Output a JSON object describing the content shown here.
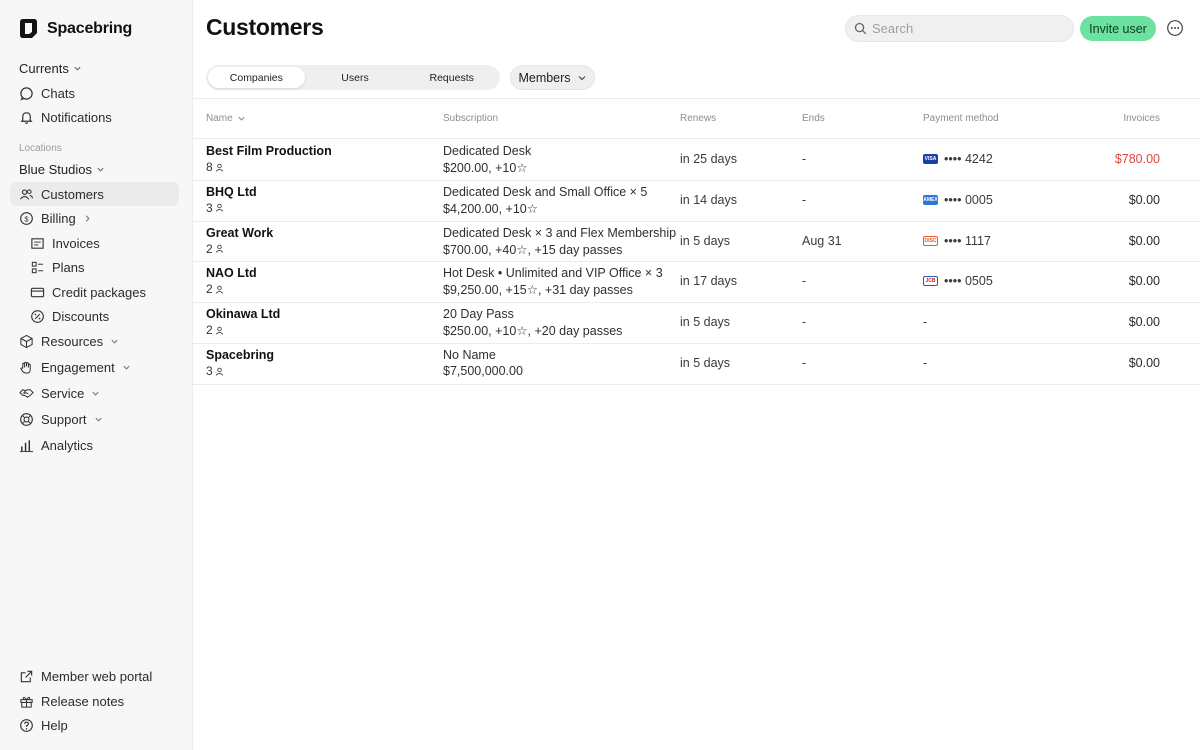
{
  "brand": {
    "name": "Spacebring"
  },
  "sidebar": {
    "currents": "Currents",
    "top_items": [
      {
        "label": "Chats",
        "icon": "chat-icon"
      },
      {
        "label": "Notifications",
        "icon": "bell-icon"
      }
    ],
    "locations_label": "Locations",
    "location": "Blue Studios",
    "items": [
      {
        "label": "Customers",
        "icon": "users-icon",
        "active": true
      },
      {
        "label": "Billing",
        "icon": "dollar-icon"
      },
      {
        "label": "Invoices",
        "icon": "invoice-icon"
      },
      {
        "label": "Plans",
        "icon": "plans-icon"
      },
      {
        "label": "Credit packages",
        "icon": "credit-card-icon"
      },
      {
        "label": "Discounts",
        "icon": "discount-icon"
      },
      {
        "label": "Resources",
        "icon": "cube-icon"
      },
      {
        "label": "Engagement",
        "icon": "hand-icon"
      },
      {
        "label": "Service",
        "icon": "handshake-icon"
      },
      {
        "label": "Support",
        "icon": "lifebuoy-icon"
      },
      {
        "label": "Analytics",
        "icon": "bar-chart-icon"
      }
    ],
    "bottom_items": [
      {
        "label": "Member web portal",
        "icon": "external-link-icon"
      },
      {
        "label": "Release notes",
        "icon": "gift-icon"
      },
      {
        "label": "Help",
        "icon": "help-icon"
      }
    ]
  },
  "header": {
    "title": "Customers",
    "search_placeholder": "Search",
    "invite_label": "Invite user"
  },
  "tabs": [
    "Companies",
    "Users",
    "Requests"
  ],
  "filter": {
    "label": "Members"
  },
  "table": {
    "columns": [
      "Name",
      "Subscription",
      "Renews",
      "Ends",
      "Payment method",
      "Invoices"
    ],
    "rows": [
      {
        "name": "Best Film Production",
        "count": "8",
        "plan": "Dedicated Desk",
        "price": "$200.00, +10☆",
        "renews": "in 25 days",
        "ends": "-",
        "card_brand": "visa",
        "card": "•••• 4242",
        "invoices": "$780.00",
        "overdue": true
      },
      {
        "name": "BHQ Ltd",
        "count": "3",
        "plan": "Dedicated Desk and Small Office × 5",
        "price": "$4,200.00, +10☆",
        "renews": "in 14 days",
        "ends": "-",
        "card_brand": "amex",
        "card": "•••• 0005",
        "invoices": "$0.00",
        "overdue": false
      },
      {
        "name": "Great Work",
        "count": "2",
        "plan": "Dedicated Desk × 3 and Flex Membership",
        "price": "$700.00, +40☆, +15 day passes",
        "renews": "in 5 days",
        "ends": "Aug 31",
        "card_brand": "discover",
        "card": "•••• 1117",
        "invoices": "$0.00",
        "overdue": false
      },
      {
        "name": "NAO Ltd",
        "count": "2",
        "plan": "Hot Desk • Unlimited and VIP Office × 3",
        "price": "$9,250.00, +15☆, +31 day passes",
        "renews": "in 17 days",
        "ends": "-",
        "card_brand": "jcb",
        "card": "•••• 0505",
        "invoices": "$0.00",
        "overdue": false
      },
      {
        "name": "Okinawa Ltd",
        "count": "2",
        "plan": "20 Day Pass",
        "price": "$250.00, +10☆, +20 day passes",
        "renews": "in 5 days",
        "ends": "-",
        "card_brand": "",
        "card": "-",
        "invoices": "$0.00",
        "overdue": false
      },
      {
        "name": "Spacebring",
        "count": "3",
        "plan": "No Name",
        "price": "$7,500,000.00",
        "renews": "in 5 days",
        "ends": "-",
        "card_brand": "",
        "card": "-",
        "invoices": "$0.00",
        "overdue": false
      }
    ]
  },
  "colors": {
    "accent": "#6be29f",
    "overdue": "#e0473a",
    "sidebar_bg": "#f7f7f7"
  }
}
